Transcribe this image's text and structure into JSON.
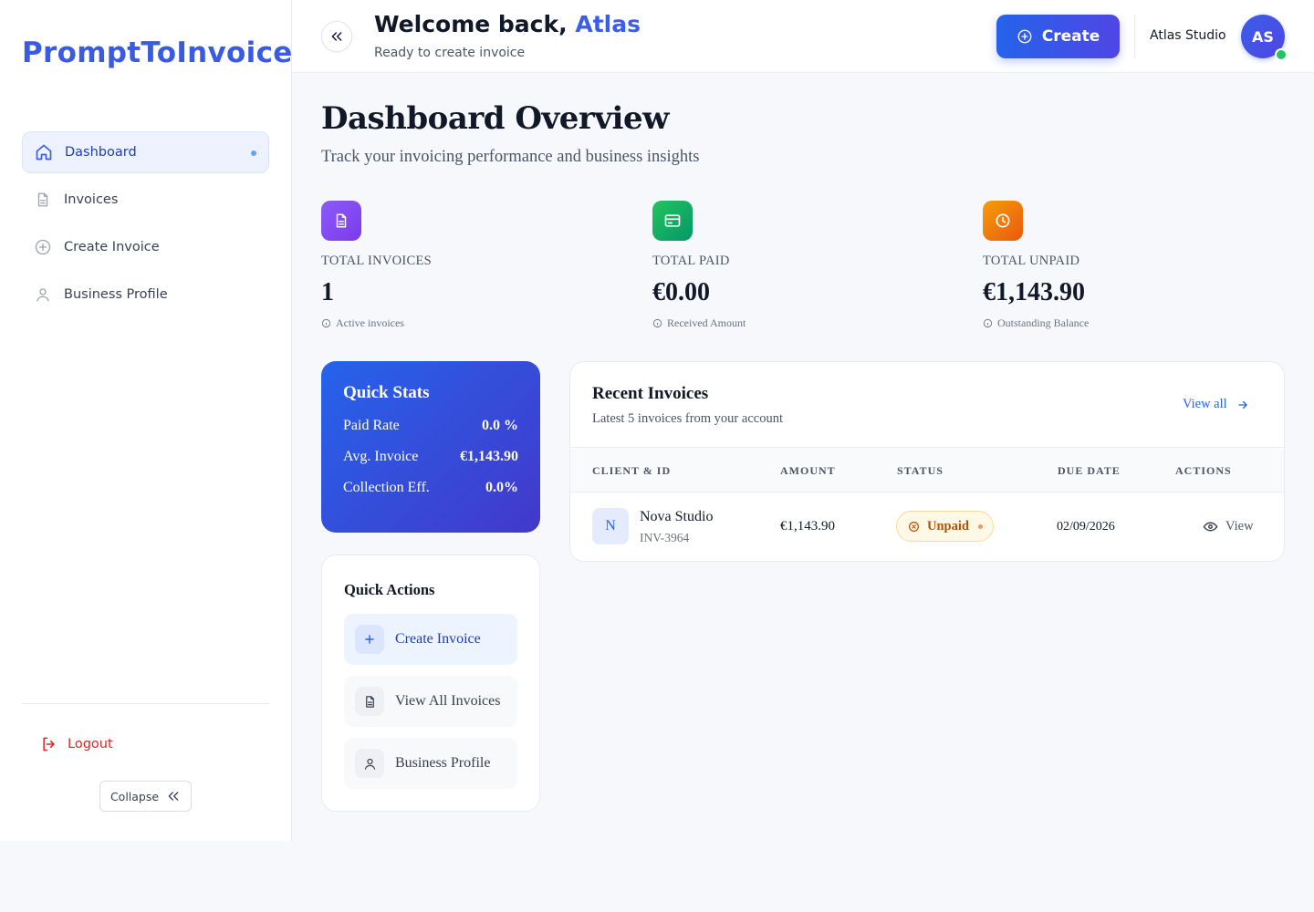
{
  "app": {
    "brand": "PromptToInvoice"
  },
  "sidebar": {
    "items": [
      {
        "label": "Dashboard",
        "icon": "home-icon",
        "active": true
      },
      {
        "label": "Invoices",
        "icon": "document-icon"
      },
      {
        "label": "Create Invoice",
        "icon": "plus-circle-icon"
      },
      {
        "label": "Business Profile",
        "icon": "user-icon"
      }
    ],
    "logout_label": "Logout",
    "collapse_label": "Collapse"
  },
  "header": {
    "welcome_prefix": "Welcome back,",
    "welcome_name": "Atlas",
    "subtitle": "Ready to create invoice",
    "create_label": "Create",
    "studio_name": "Atlas Studio",
    "avatar_initials": "AS"
  },
  "main": {
    "title": "Dashboard Overview",
    "subtitle": "Track your invoicing performance and business insights",
    "stats": [
      {
        "label": "TOTAL INVOICES",
        "value": "1",
        "note": "Active invoices",
        "color": "#7c4dea"
      },
      {
        "label": "TOTAL PAID",
        "value": "€0.00",
        "note": "Received Amount",
        "color": "#16a34a"
      },
      {
        "label": "TOTAL UNPAID",
        "value": "€1,143.90",
        "note": "Outstanding Balance",
        "color": "#f59e0b"
      }
    ],
    "quick_stats": {
      "title": "Quick Stats",
      "rows": [
        {
          "label": "Paid Rate",
          "value": "0.0 %"
        },
        {
          "label": "Avg. Invoice",
          "value": "€1,143.90"
        },
        {
          "label": "Collection Eff.",
          "value": "0.0%"
        }
      ]
    },
    "quick_actions": {
      "title": "Quick Actions",
      "items": [
        {
          "label": "Create Invoice",
          "icon": "plus-icon"
        },
        {
          "label": "View All Invoices",
          "icon": "document-icon"
        },
        {
          "label": "Business Profile",
          "icon": "user-icon"
        }
      ]
    },
    "recent": {
      "title": "Recent Invoices",
      "subtitle": "Latest 5 invoices from your account",
      "view_all": "View all",
      "columns": [
        "CLIENT & ID",
        "AMOUNT",
        "STATUS",
        "DUE DATE",
        "ACTIONS"
      ],
      "rows": [
        {
          "initial": "N",
          "client": "Nova Studio",
          "id": "INV-3964",
          "amount": "€1,143.90",
          "status": "Unpaid",
          "due": "02/09/2026",
          "action": "View"
        }
      ]
    }
  }
}
